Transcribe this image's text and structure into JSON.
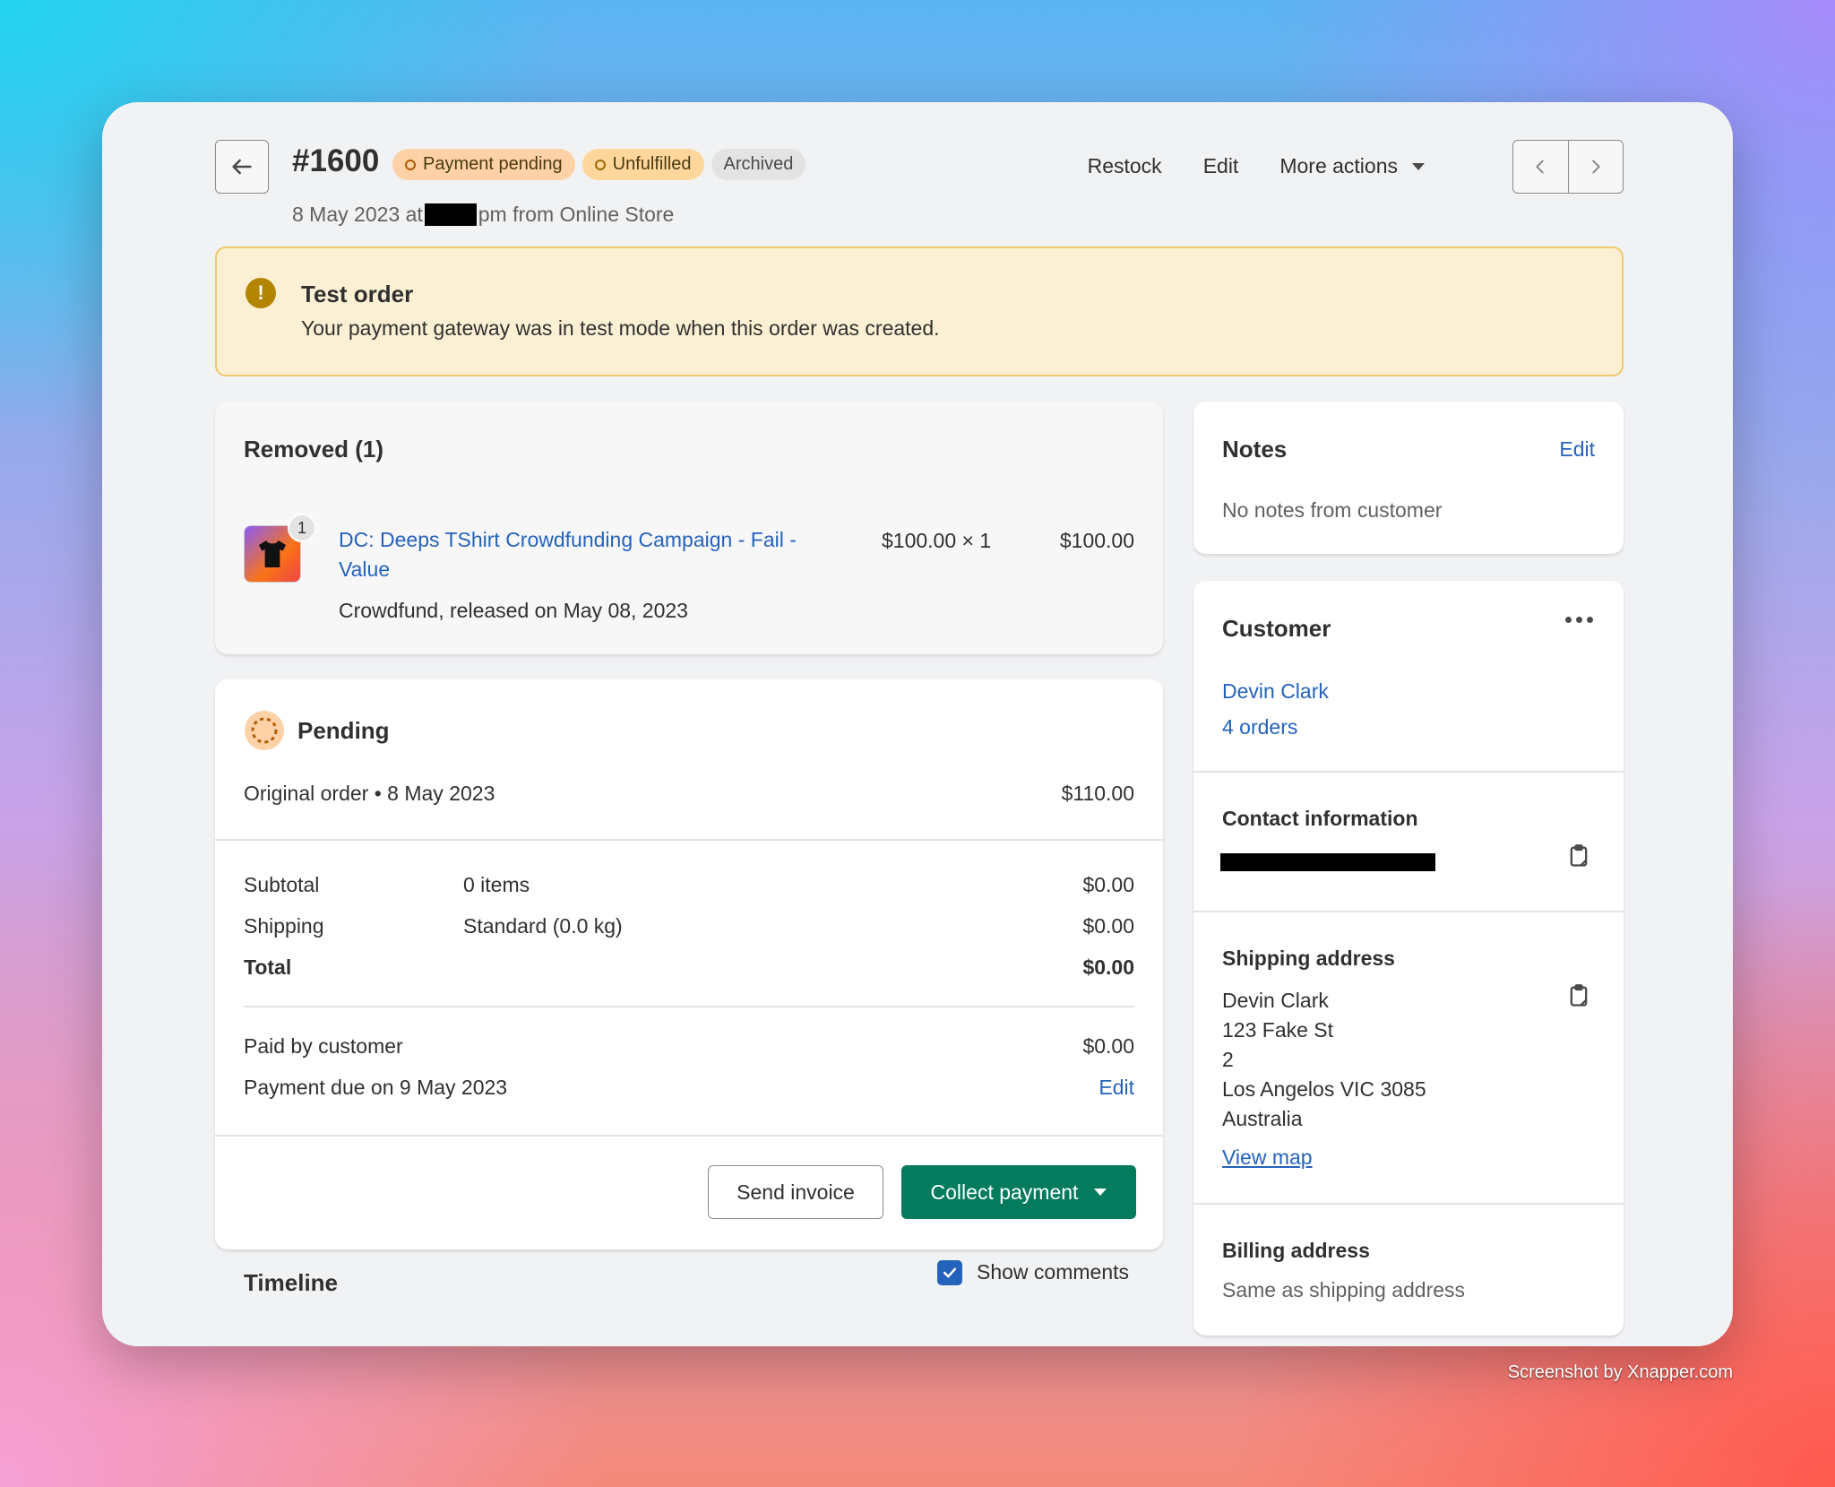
{
  "header": {
    "order_number": "#1600",
    "badges": {
      "payment": "Payment pending",
      "fulfillment": "Unfulfilled",
      "archived": "Archived"
    },
    "date_prefix": "8 May 2023 at",
    "date_suffix": "pm from Online Store",
    "actions": {
      "restock": "Restock",
      "edit": "Edit",
      "more": "More actions"
    }
  },
  "banner": {
    "title": "Test order",
    "text": "Your payment gateway was in test mode when this order was created."
  },
  "removed": {
    "title": "Removed (1)",
    "item": {
      "qty_badge": "1",
      "name_line1": "DC: Deeps TShirt Crowdfunding Campaign - Fail -",
      "name_line2": "Value",
      "unit": "$100.00 × 1",
      "total": "$100.00",
      "note": "Crowdfund, released on May 08, 2023"
    }
  },
  "pending": {
    "title": "Pending",
    "original_label": "Original order • 8 May 2023",
    "original_value": "$110.00",
    "rows": {
      "subtotal": {
        "label": "Subtotal",
        "desc": "0 items",
        "value": "$0.00"
      },
      "shipping": {
        "label": "Shipping",
        "desc": "Standard (0.0 kg)",
        "value": "$0.00"
      },
      "total": {
        "label": "Total",
        "value": "$0.00"
      }
    },
    "paid_label": "Paid by customer",
    "paid_value": "$0.00",
    "due_label": "Payment due on 9 May 2023",
    "due_edit": "Edit",
    "send_invoice": "Send invoice",
    "collect_payment": "Collect payment"
  },
  "timeline": {
    "title": "Timeline",
    "show_comments": "Show comments",
    "show_comments_checked": true
  },
  "notes": {
    "title": "Notes",
    "edit": "Edit",
    "text": "No notes from customer"
  },
  "customer": {
    "title": "Customer",
    "name": "Devin Clark",
    "orders": "4 orders",
    "contact_title": "Contact information",
    "shipping_title": "Shipping address",
    "shipping_lines": [
      "Devin Clark",
      "123 Fake St",
      "2",
      "Los Angelos VIC 3085",
      "Australia"
    ],
    "view_map": "View map",
    "billing_title": "Billing address",
    "billing_text": "Same as shipping address"
  },
  "credit": "Screenshot by Xnapper.com",
  "colors": {
    "primary": "#047b5d",
    "link": "#2463bc",
    "banner_bg": "#fcf0d4"
  }
}
